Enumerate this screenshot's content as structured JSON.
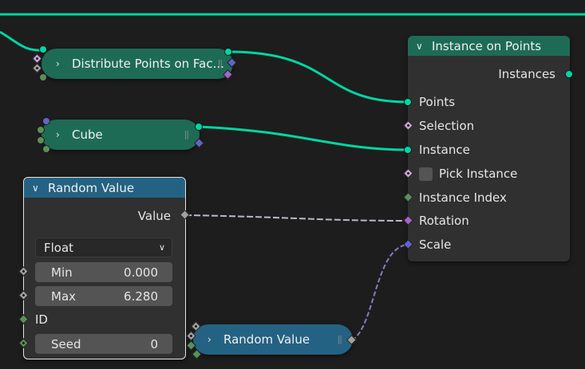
{
  "colors": {
    "background": "#1d1d1d",
    "node_body": "#303030",
    "geometry_header": "#1e6b55",
    "utility_header": "#246283",
    "geometry_link": "#00d6a3",
    "geometry_socket": "#00d6a3",
    "field_socket": "#cca6d6",
    "rotation_socket": "#a663c7",
    "vector_socket": "#6363c7",
    "float_socket": "#a1a1a1",
    "int_socket": "#5a8f5a"
  },
  "instance_on_points": {
    "title": "Instance on Points",
    "output": "Instances",
    "inputs": {
      "points": "Points",
      "selection": "Selection",
      "instance": "Instance",
      "pick_instance": "Pick Instance",
      "instance_index": "Instance Index",
      "rotation": "Rotation",
      "scale": "Scale"
    }
  },
  "distribute": {
    "title": "Distribute Points on Fac..."
  },
  "cube": {
    "title": "Cube"
  },
  "random_value": {
    "title": "Random Value",
    "output": "Value",
    "data_type": "Float",
    "min_label": "Min",
    "min_value": "0.000",
    "max_label": "Max",
    "max_value": "6.280",
    "id_label": "ID",
    "seed_label": "Seed",
    "seed_value": "0"
  },
  "random_value_collapsed": {
    "title": "Random Value"
  },
  "icons": {
    "expand": "chevron-down-icon",
    "collapsed": "chevron-right-icon",
    "dropdown": "chevron-down-icon",
    "grip": "grip-icon"
  }
}
